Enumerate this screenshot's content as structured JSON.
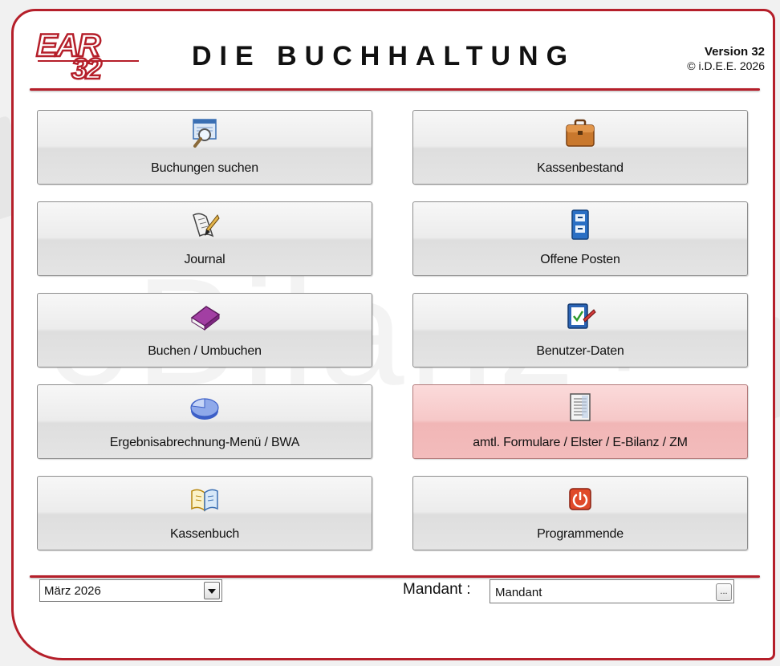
{
  "header": {
    "logo_text": "EAR 32",
    "title": "DIE BUCHHALTUNG",
    "version": "Version 32",
    "copyright": "© i.D.E.E. 2026"
  },
  "watermark": "eBilanz+",
  "buttons": [
    {
      "label": "Buchungen suchen",
      "icon": "search-document-icon"
    },
    {
      "label": "Kassenbestand",
      "icon": "briefcase-icon"
    },
    {
      "label": "Journal",
      "icon": "scroll-quill-icon"
    },
    {
      "label": "Offene Posten",
      "icon": "file-cabinet-icon"
    },
    {
      "label": "Buchen / Umbuchen",
      "icon": "book-icon"
    },
    {
      "label": "Benutzer-Daten",
      "icon": "clipboard-pen-icon"
    },
    {
      "label": "Ergebnisabrechnung-Menü / BWA",
      "icon": "pie-chart-icon"
    },
    {
      "label": "amtl. Formulare / Elster / E-Bilanz / ZM",
      "icon": "document-icon"
    },
    {
      "label": "Kassenbuch",
      "icon": "open-book-icon"
    },
    {
      "label": "Programmende",
      "icon": "power-icon"
    }
  ],
  "footer": {
    "month_value": "März 2026",
    "mandant_label": "Mandant :",
    "mandant_value": "Mandant",
    "browse_label": "..."
  },
  "colors": {
    "accent": "#b51f2a",
    "highlight_button": "#f6c8c8"
  }
}
